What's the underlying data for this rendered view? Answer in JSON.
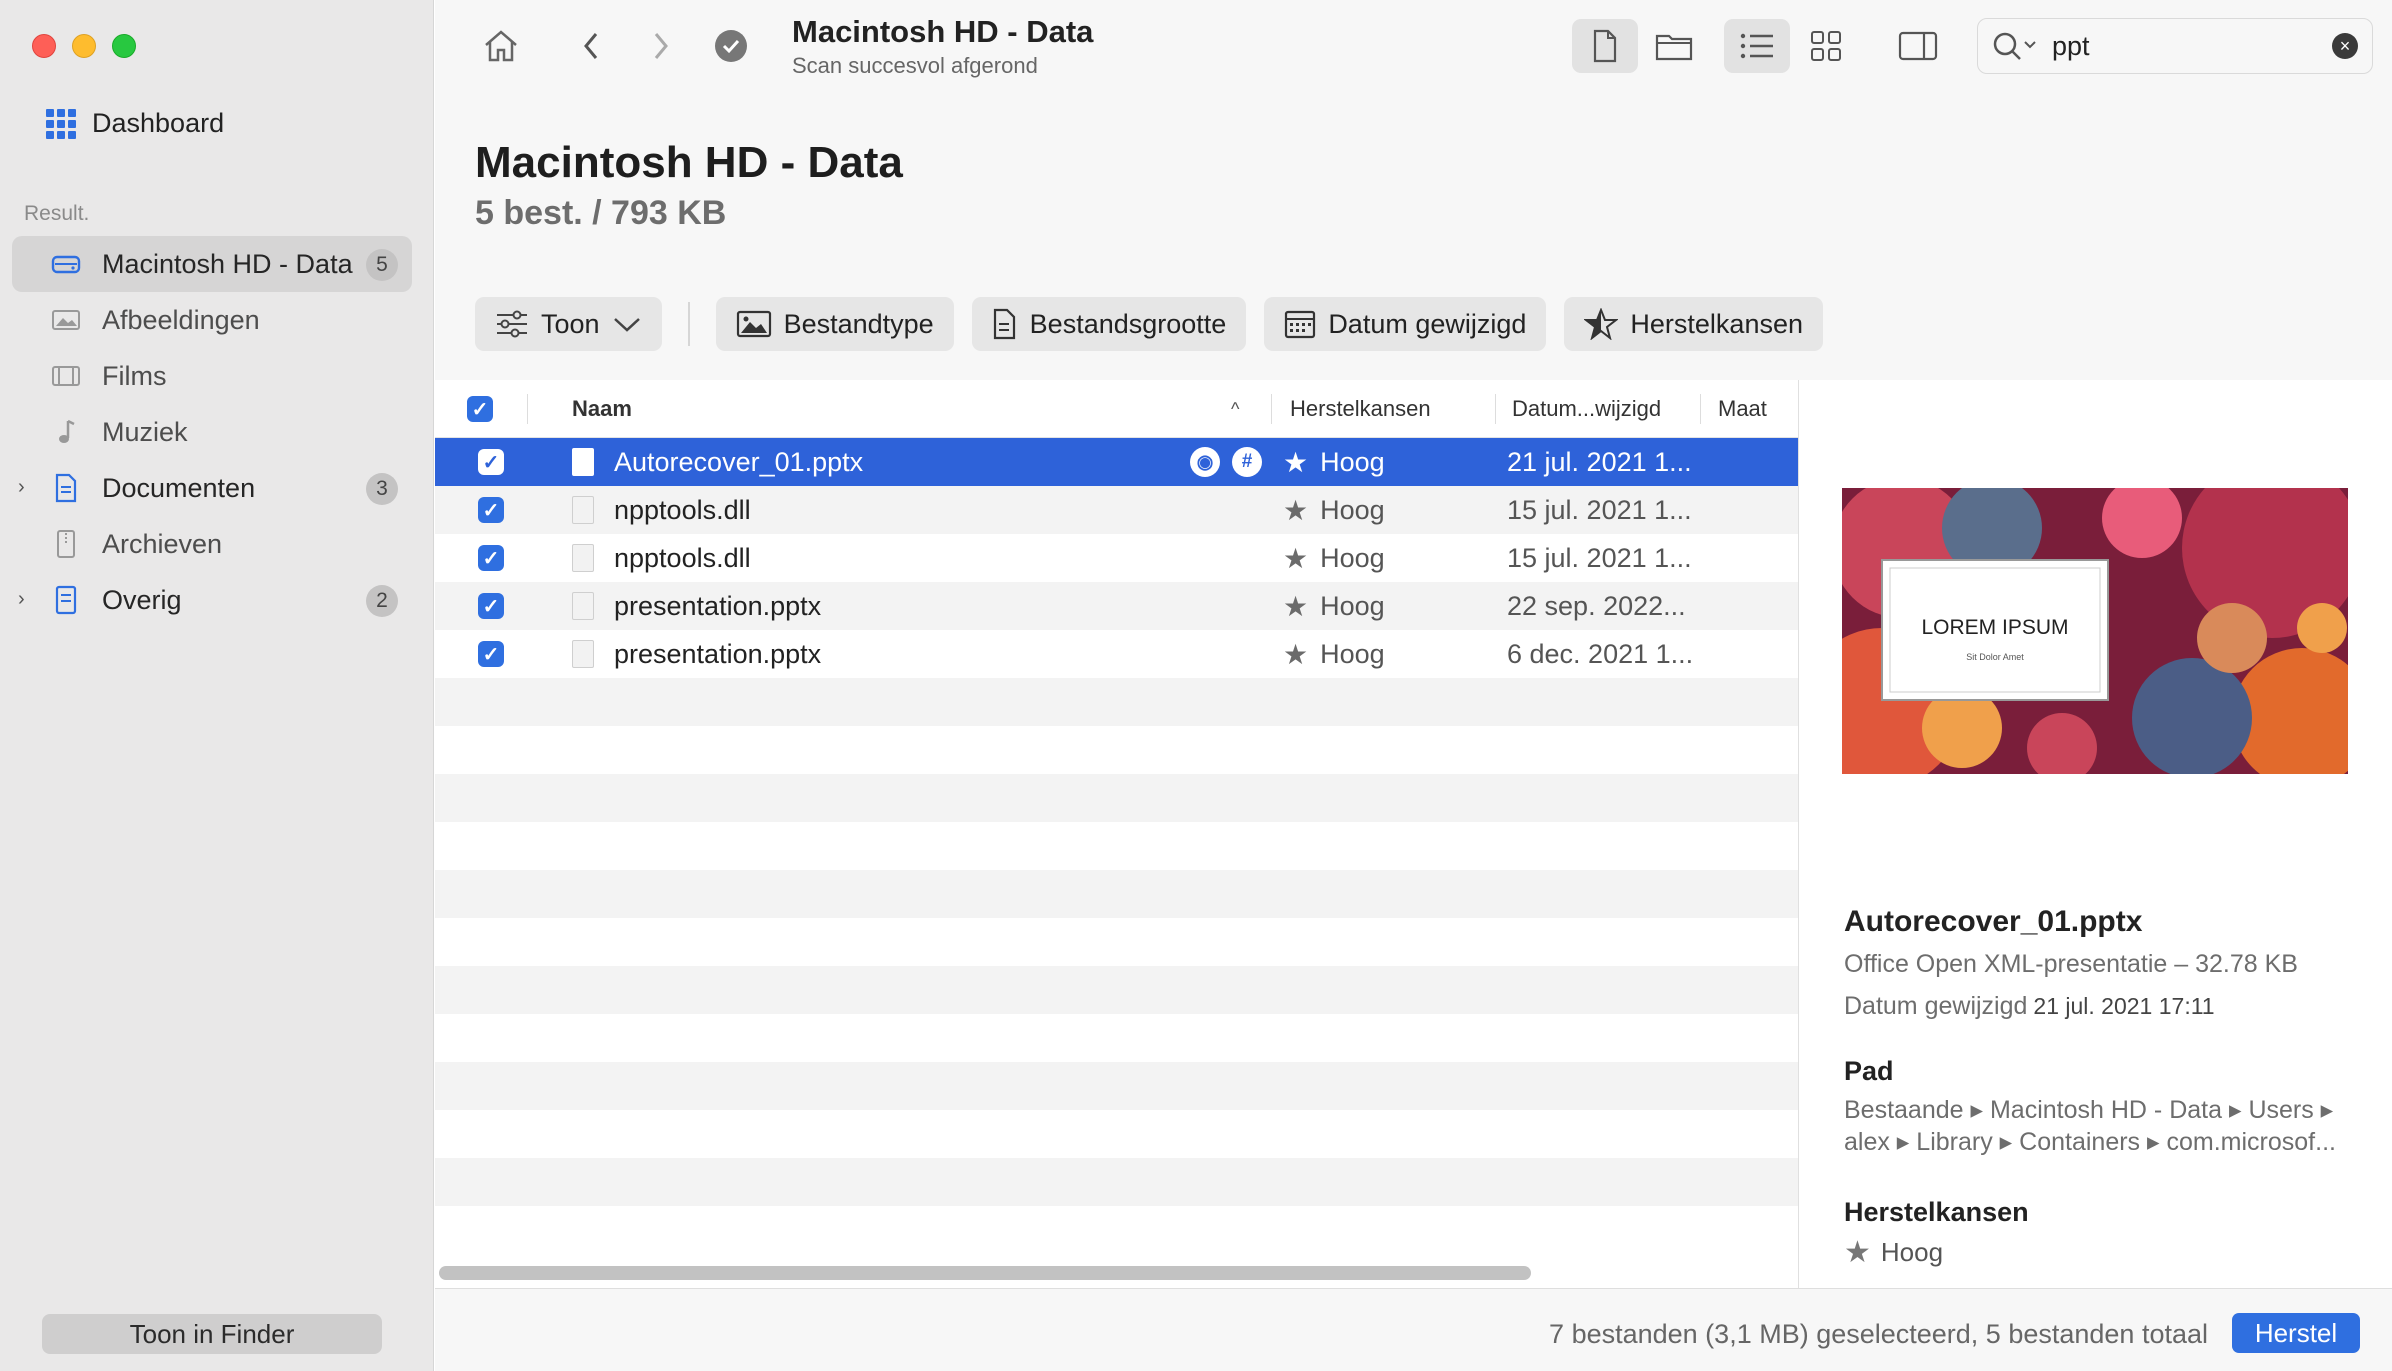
{
  "sidebar": {
    "dashboard": "Dashboard",
    "result_label": "Result.",
    "items": [
      {
        "label": "Macintosh HD - Data",
        "badge": "5",
        "icon": "drive-icon"
      },
      {
        "label": "Afbeeldingen",
        "badge": "",
        "icon": "image-icon"
      },
      {
        "label": "Films",
        "badge": "",
        "icon": "film-icon"
      },
      {
        "label": "Muziek",
        "badge": "",
        "icon": "music-icon"
      },
      {
        "label": "Documenten",
        "badge": "3",
        "icon": "document-icon"
      },
      {
        "label": "Archieven",
        "badge": "",
        "icon": "archive-icon"
      },
      {
        "label": "Overig",
        "badge": "2",
        "icon": "other-icon"
      }
    ],
    "finder_button": "Toon in Finder"
  },
  "toolbar": {
    "title": "Macintosh HD - Data",
    "subtitle": "Scan succesvol afgerond",
    "search_value": "ppt"
  },
  "header": {
    "title": "Macintosh HD - Data",
    "subtitle": "5 best. / 793 KB",
    "filters": {
      "toon": "Toon",
      "bestandtype": "Bestandtype",
      "bestandsgrootte": "Bestandsgrootte",
      "datum": "Datum gewijzigd",
      "herstelkansen": "Herstelkansen"
    }
  },
  "table": {
    "columns": {
      "naam": "Naam",
      "herstelkansen": "Herstelkansen",
      "datum": "Datum...wijzigd",
      "maat": "Maat"
    },
    "rows": [
      {
        "name": "Autorecover_01.pptx",
        "chance": "Hoog",
        "date": "21 jul. 2021 1..."
      },
      {
        "name": "npptools.dll",
        "chance": "Hoog",
        "date": "15 jul. 2021 1..."
      },
      {
        "name": "npptools.dll",
        "chance": "Hoog",
        "date": "15 jul. 2021 1..."
      },
      {
        "name": "presentation.pptx",
        "chance": "Hoog",
        "date": "22 sep. 2022..."
      },
      {
        "name": "presentation.pptx",
        "chance": "Hoog",
        "date": "6 dec. 2021 1..."
      }
    ]
  },
  "preview": {
    "thumb_title": "LOREM IPSUM",
    "thumb_sub": "Sit Dolor Amet",
    "name": "Autorecover_01.pptx",
    "type": "Office Open XML-presentatie – 32.78 KB",
    "date_label": "Datum gewijzigd",
    "date_value": "21 jul. 2021 17:11",
    "pad_label": "Pad",
    "path_line1": "Bestaande ▸ Macintosh HD - Data ▸ Users ▸",
    "path_line2": "alex ▸ Library ▸ Containers ▸ com.microsof...",
    "chance_label": "Herstelkansen",
    "chance_value": "Hoog"
  },
  "footer": {
    "status": "7 bestanden (3,1 MB) geselecteerd, 5 bestanden totaal",
    "button": "Herstel"
  },
  "colors": {
    "accent": "#2f6fe0",
    "selection": "#2e62d9"
  }
}
